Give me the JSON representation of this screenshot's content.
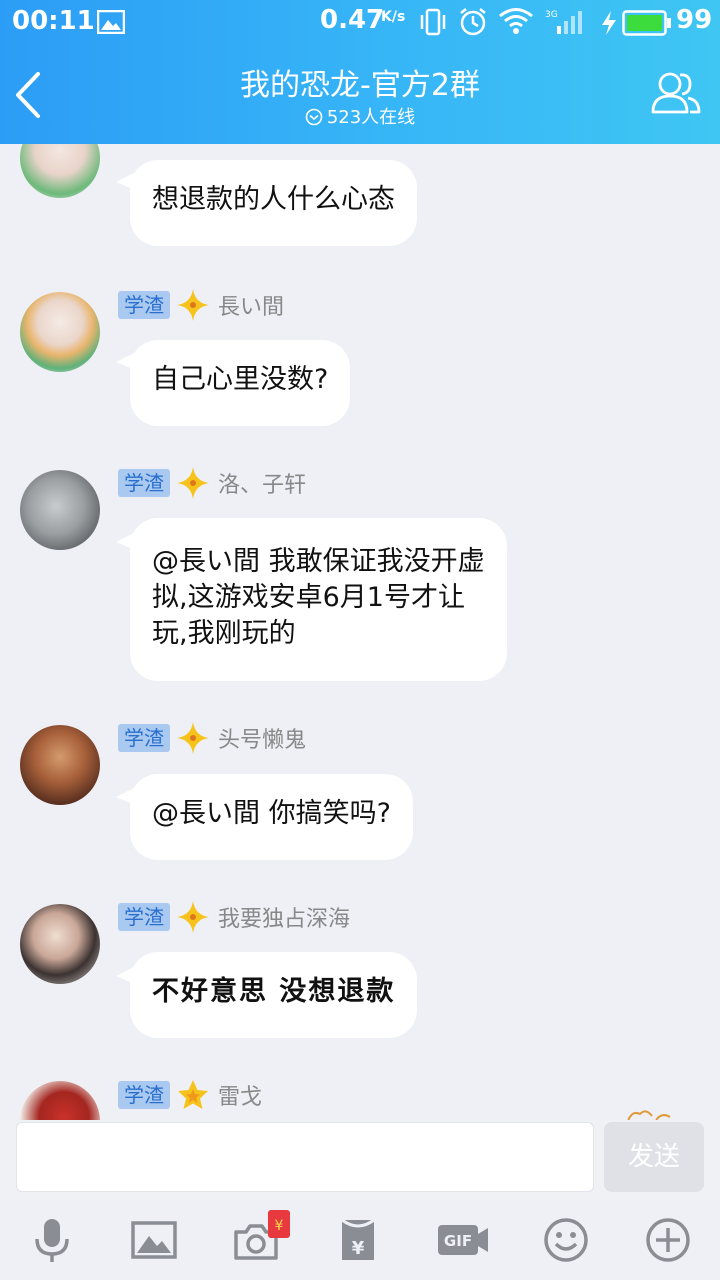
{
  "status_bar": {
    "time": "00:11",
    "network_speed": "0.47",
    "network_unit": "K/s",
    "network_type": "3G",
    "battery": "99"
  },
  "header": {
    "title": "我的恐龙-官方2群",
    "online_count": "523人在线"
  },
  "messages": [
    {
      "badge": "",
      "nickname": "",
      "text": "想退款的人什么心态"
    },
    {
      "badge": "学渣",
      "nickname": "長い間",
      "text": "自己心里没数?"
    },
    {
      "badge": "学渣",
      "nickname": "洛、子轩",
      "text_lines": [
        "@長い間 我敢保证我没开虚",
        "拟,这游戏安卓6月1号才让",
        "玩,我刚玩的"
      ]
    },
    {
      "badge": "学渣",
      "nickname": "头号懒鬼",
      "text": "@長い間 你搞笑吗?"
    },
    {
      "badge": "学渣",
      "nickname": "我要独占深海",
      "text": "不好意思 没想退款"
    },
    {
      "badge": "学渣",
      "nickname": "雷戈",
      "text": ""
    }
  ],
  "input": {
    "placeholder": "",
    "send_label": "发送"
  },
  "toolbar": {
    "items": [
      "mic-icon",
      "image-icon",
      "camera-icon",
      "redpacket-icon",
      "gif-icon",
      "emoji-icon",
      "plus-icon"
    ]
  },
  "colors": {
    "header_start": "#2c9df6",
    "header_end": "#3fc6f3",
    "badge_bg": "#a9c9f0",
    "badge_text": "#2a6fce",
    "background": "#eef0f6"
  }
}
